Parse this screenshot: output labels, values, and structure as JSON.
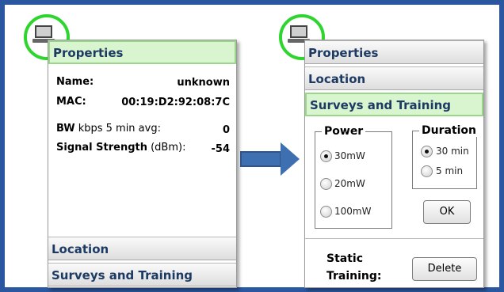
{
  "left_panel": {
    "header": "Properties",
    "name_label": "Name:",
    "name_value": "unknown",
    "mac_label": "MAC:",
    "mac_value": "00:19:D2:92:08:7C",
    "bw_label_bold": "BW",
    "bw_label_rest": "kbps 5 min avg:",
    "bw_value": "0",
    "signal_label_bold": "Signal Strength",
    "signal_label_rest": "(dBm):",
    "signal_value": "-54",
    "location_header": "Location",
    "surveys_header": "Surveys and Training"
  },
  "right_panel": {
    "properties_header": "Properties",
    "location_header": "Location",
    "surveys_header": "Surveys and Training",
    "power": {
      "legend": "Power",
      "options": [
        "30mW",
        "20mW",
        "100mW"
      ],
      "selected": "30mW"
    },
    "duration": {
      "legend": "Duration",
      "options": [
        "30 min",
        "5 min"
      ],
      "selected": "30 min"
    },
    "ok_label": "OK",
    "static_training_label_1": "Static",
    "static_training_label_2": "Training:",
    "delete_label": "Delete"
  },
  "colors": {
    "frame": "#2a57a0",
    "active_header": "#d9f5d0",
    "device_ring": "#2fd52f",
    "arrow": "#3e6fb0"
  }
}
